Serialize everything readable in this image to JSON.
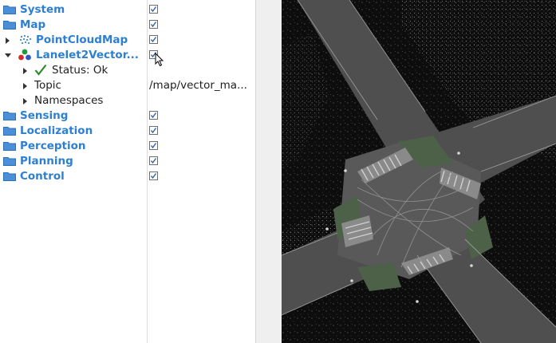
{
  "tree": {
    "system": {
      "label": "System"
    },
    "map": {
      "label": "Map"
    },
    "point_cloud_map": {
      "label": "PointCloudMap"
    },
    "lanelet2": {
      "label": "Lanelet2Vector..."
    },
    "status": {
      "label": "Status: Ok"
    },
    "topic": {
      "label": "Topic",
      "value": "/map/vector_ma..."
    },
    "namespaces": {
      "label": "Namespaces"
    },
    "sensing": {
      "label": "Sensing"
    },
    "localization": {
      "label": "Localization"
    },
    "perception": {
      "label": "Perception"
    },
    "planning": {
      "label": "Planning"
    },
    "control": {
      "label": "Control"
    }
  },
  "colors": {
    "label_blue": "#2d7fd1",
    "folder_blue": "#4a8fd8",
    "status_green": "#2a8a2a",
    "road_gray": "#4f4f4f",
    "area_green": "#4c6148"
  },
  "icons": [
    "folder-icon",
    "point-cloud-icon",
    "lanelet-icon",
    "checkmark-icon",
    "checkbox-icon",
    "cursor-icon"
  ]
}
